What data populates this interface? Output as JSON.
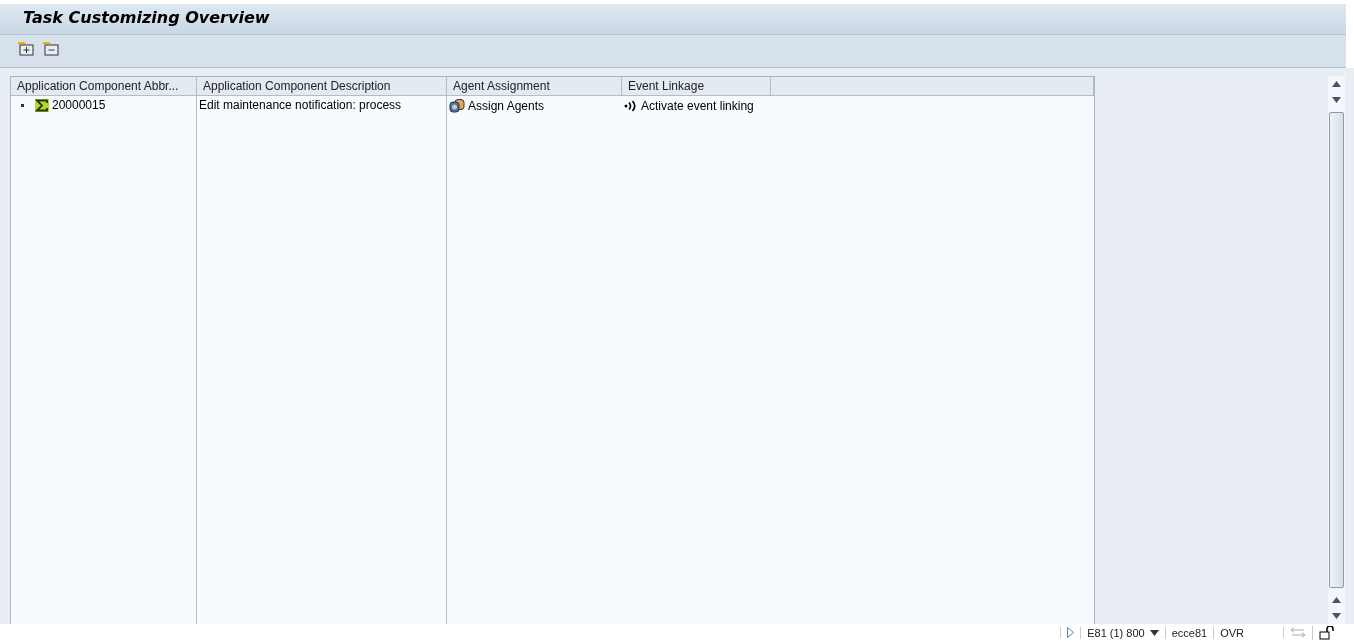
{
  "window": {
    "title": "Task Customizing Overview"
  },
  "toolbar": {
    "buttons": [
      {
        "kind": "expand"
      },
      {
        "kind": "collapse"
      }
    ]
  },
  "table": {
    "columns": [
      "Application Component Abbr...",
      "Application Component Description",
      "Agent Assignment",
      "Event Linkage"
    ],
    "rows": [
      {
        "abbreviation": "20000015",
        "description": "Edit maintenance notification: process",
        "agent_assignment": "Assign Agents",
        "event_linkage": "Activate event linking"
      }
    ]
  },
  "status_bar": {
    "system": "E81 (1) 800",
    "server": "ecce81",
    "mode": "OVR"
  }
}
